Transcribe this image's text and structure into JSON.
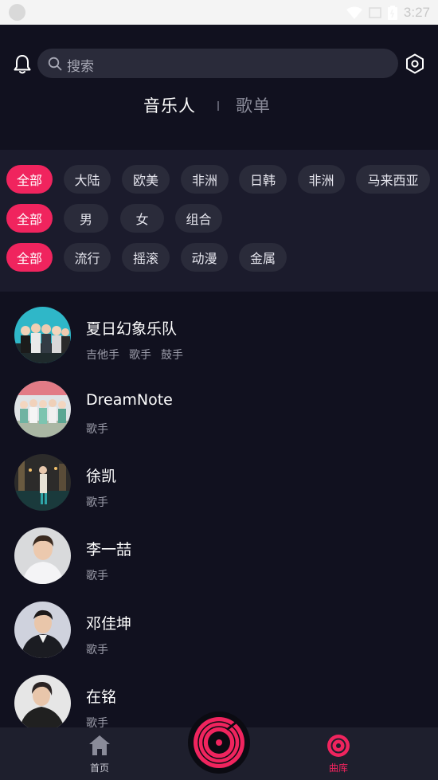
{
  "status_bar": {
    "time": "3:27"
  },
  "header": {
    "search": {
      "placeholder": "搜索"
    },
    "tabs": [
      {
        "label": "音乐人",
        "active": true
      },
      {
        "label": "歌单",
        "active": false
      }
    ]
  },
  "filters": {
    "region": [
      "全部",
      "大陆",
      "欧美",
      "非洲",
      "日韩",
      "非洲",
      "马来西亚"
    ],
    "gender": [
      "全部",
      "男",
      "女",
      "组合"
    ],
    "genre": [
      "全部",
      "流行",
      "摇滚",
      "动漫",
      "金属"
    ],
    "active_color": "#f0245e"
  },
  "artists": [
    {
      "name": "夏日幻象乐队",
      "roles": [
        "吉他手",
        "歌手",
        "鼓手"
      ]
    },
    {
      "name": "DreamNote",
      "roles": [
        "歌手"
      ]
    },
    {
      "name": "徐凯",
      "roles": [
        "歌手"
      ]
    },
    {
      "name": "李一喆",
      "roles": [
        "歌手"
      ]
    },
    {
      "name": "邓佳坤",
      "roles": [
        "歌手"
      ]
    },
    {
      "name": "在铭",
      "roles": [
        "歌手"
      ]
    }
  ],
  "bottom_nav": {
    "home": {
      "label": "首页",
      "icon": "home-icon"
    },
    "center": {
      "icon": "vinyl-disc-icon"
    },
    "library": {
      "label": "曲库",
      "icon": "music-library-icon",
      "active": true
    }
  }
}
